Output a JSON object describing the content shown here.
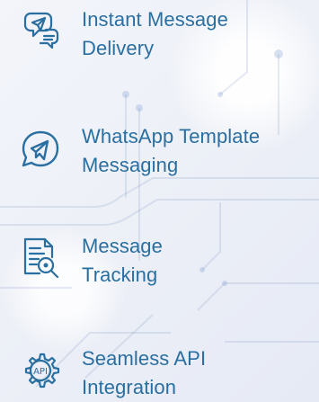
{
  "features": [
    {
      "title_line_1": "Instant Message",
      "title_line_2": "Delivery",
      "icon": "chat-send-icon"
    },
    {
      "title_line_1": "WhatsApp Template",
      "title_line_2": "Messaging",
      "icon": "whatsapp-telegram-icon"
    },
    {
      "title_line_1": "Message",
      "title_line_2": "Tracking",
      "icon": "document-search-icon"
    },
    {
      "title_line_1": "Seamless API",
      "title_line_2": "Integration",
      "icon": "api-gear-icon"
    }
  ],
  "colors": {
    "accent": "#2a6fa1",
    "background": "#eef0f7"
  }
}
